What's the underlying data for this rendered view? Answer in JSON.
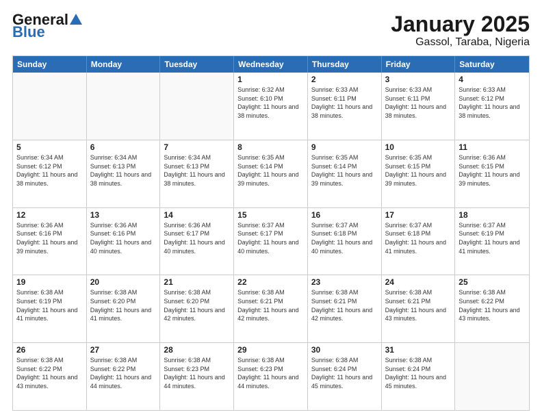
{
  "logo": {
    "general": "General",
    "blue": "Blue"
  },
  "title": "January 2025",
  "subtitle": "Gassol, Taraba, Nigeria",
  "headers": [
    "Sunday",
    "Monday",
    "Tuesday",
    "Wednesday",
    "Thursday",
    "Friday",
    "Saturday"
  ],
  "rows": [
    [
      {
        "day": "",
        "info": ""
      },
      {
        "day": "",
        "info": ""
      },
      {
        "day": "",
        "info": ""
      },
      {
        "day": "1",
        "info": "Sunrise: 6:32 AM\nSunset: 6:10 PM\nDaylight: 11 hours and 38 minutes."
      },
      {
        "day": "2",
        "info": "Sunrise: 6:33 AM\nSunset: 6:11 PM\nDaylight: 11 hours and 38 minutes."
      },
      {
        "day": "3",
        "info": "Sunrise: 6:33 AM\nSunset: 6:11 PM\nDaylight: 11 hours and 38 minutes."
      },
      {
        "day": "4",
        "info": "Sunrise: 6:33 AM\nSunset: 6:12 PM\nDaylight: 11 hours and 38 minutes."
      }
    ],
    [
      {
        "day": "5",
        "info": "Sunrise: 6:34 AM\nSunset: 6:12 PM\nDaylight: 11 hours and 38 minutes."
      },
      {
        "day": "6",
        "info": "Sunrise: 6:34 AM\nSunset: 6:13 PM\nDaylight: 11 hours and 38 minutes."
      },
      {
        "day": "7",
        "info": "Sunrise: 6:34 AM\nSunset: 6:13 PM\nDaylight: 11 hours and 38 minutes."
      },
      {
        "day": "8",
        "info": "Sunrise: 6:35 AM\nSunset: 6:14 PM\nDaylight: 11 hours and 39 minutes."
      },
      {
        "day": "9",
        "info": "Sunrise: 6:35 AM\nSunset: 6:14 PM\nDaylight: 11 hours and 39 minutes."
      },
      {
        "day": "10",
        "info": "Sunrise: 6:35 AM\nSunset: 6:15 PM\nDaylight: 11 hours and 39 minutes."
      },
      {
        "day": "11",
        "info": "Sunrise: 6:36 AM\nSunset: 6:15 PM\nDaylight: 11 hours and 39 minutes."
      }
    ],
    [
      {
        "day": "12",
        "info": "Sunrise: 6:36 AM\nSunset: 6:16 PM\nDaylight: 11 hours and 39 minutes."
      },
      {
        "day": "13",
        "info": "Sunrise: 6:36 AM\nSunset: 6:16 PM\nDaylight: 11 hours and 40 minutes."
      },
      {
        "day": "14",
        "info": "Sunrise: 6:36 AM\nSunset: 6:17 PM\nDaylight: 11 hours and 40 minutes."
      },
      {
        "day": "15",
        "info": "Sunrise: 6:37 AM\nSunset: 6:17 PM\nDaylight: 11 hours and 40 minutes."
      },
      {
        "day": "16",
        "info": "Sunrise: 6:37 AM\nSunset: 6:18 PM\nDaylight: 11 hours and 40 minutes."
      },
      {
        "day": "17",
        "info": "Sunrise: 6:37 AM\nSunset: 6:18 PM\nDaylight: 11 hours and 41 minutes."
      },
      {
        "day": "18",
        "info": "Sunrise: 6:37 AM\nSunset: 6:19 PM\nDaylight: 11 hours and 41 minutes."
      }
    ],
    [
      {
        "day": "19",
        "info": "Sunrise: 6:38 AM\nSunset: 6:19 PM\nDaylight: 11 hours and 41 minutes."
      },
      {
        "day": "20",
        "info": "Sunrise: 6:38 AM\nSunset: 6:20 PM\nDaylight: 11 hours and 41 minutes."
      },
      {
        "day": "21",
        "info": "Sunrise: 6:38 AM\nSunset: 6:20 PM\nDaylight: 11 hours and 42 minutes."
      },
      {
        "day": "22",
        "info": "Sunrise: 6:38 AM\nSunset: 6:21 PM\nDaylight: 11 hours and 42 minutes."
      },
      {
        "day": "23",
        "info": "Sunrise: 6:38 AM\nSunset: 6:21 PM\nDaylight: 11 hours and 42 minutes."
      },
      {
        "day": "24",
        "info": "Sunrise: 6:38 AM\nSunset: 6:21 PM\nDaylight: 11 hours and 43 minutes."
      },
      {
        "day": "25",
        "info": "Sunrise: 6:38 AM\nSunset: 6:22 PM\nDaylight: 11 hours and 43 minutes."
      }
    ],
    [
      {
        "day": "26",
        "info": "Sunrise: 6:38 AM\nSunset: 6:22 PM\nDaylight: 11 hours and 43 minutes."
      },
      {
        "day": "27",
        "info": "Sunrise: 6:38 AM\nSunset: 6:22 PM\nDaylight: 11 hours and 44 minutes."
      },
      {
        "day": "28",
        "info": "Sunrise: 6:38 AM\nSunset: 6:23 PM\nDaylight: 11 hours and 44 minutes."
      },
      {
        "day": "29",
        "info": "Sunrise: 6:38 AM\nSunset: 6:23 PM\nDaylight: 11 hours and 44 minutes."
      },
      {
        "day": "30",
        "info": "Sunrise: 6:38 AM\nSunset: 6:24 PM\nDaylight: 11 hours and 45 minutes."
      },
      {
        "day": "31",
        "info": "Sunrise: 6:38 AM\nSunset: 6:24 PM\nDaylight: 11 hours and 45 minutes."
      },
      {
        "day": "",
        "info": ""
      }
    ]
  ]
}
